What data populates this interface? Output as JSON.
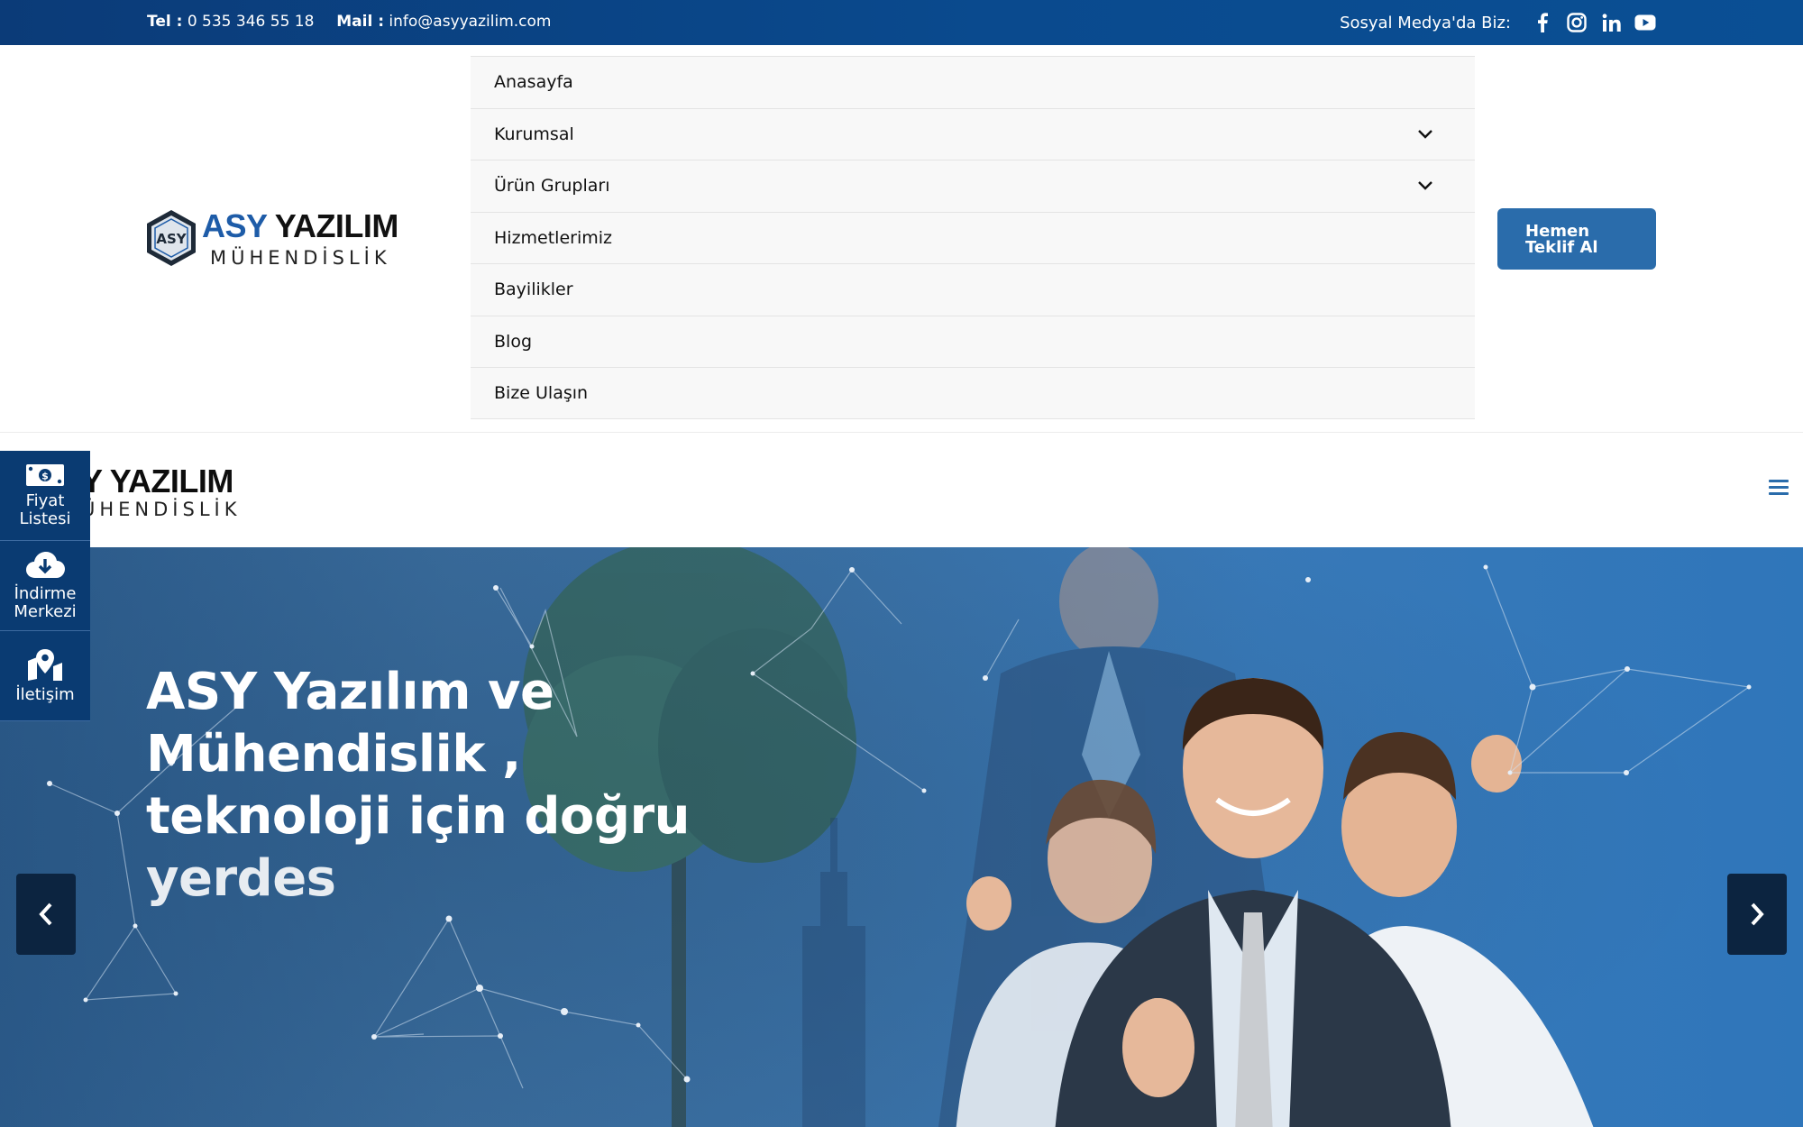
{
  "topbar": {
    "tel_label": "Tel :",
    "tel_value": "0 535 346 55 18",
    "mail_label": "Mail :",
    "mail_value": "info@asyyazilim.com",
    "social_label": "Sosyal Medya'da Biz:",
    "social_icons": [
      "facebook-icon",
      "instagram-icon",
      "linkedin-icon",
      "youtube-icon"
    ]
  },
  "logo": {
    "badge": "ASY",
    "word1": "ASY",
    "word2": "YAZILIM",
    "subtitle": "MÜHENDİSLİK"
  },
  "nav": {
    "items": [
      {
        "label": "Anasayfa",
        "has_dropdown": false
      },
      {
        "label": "Kurumsal",
        "has_dropdown": true
      },
      {
        "label": "Ürün Grupları",
        "has_dropdown": true
      },
      {
        "label": "Hizmetlerimiz",
        "has_dropdown": false
      },
      {
        "label": "Bayilikler",
        "has_dropdown": false
      },
      {
        "label": "Blog",
        "has_dropdown": false
      },
      {
        "label": "Bize Ulaşın",
        "has_dropdown": false
      }
    ]
  },
  "cta": {
    "line1": "Hemen",
    "line2": "Teklif Al"
  },
  "sticky": {
    "logo_title": "Y YAZILIM",
    "logo_subtitle": "ÜHENDİSLİK"
  },
  "side_panel": [
    {
      "line1": "Fiyat",
      "line2": "Listesi",
      "icon": "money-icon"
    },
    {
      "line1": "İndirme",
      "line2": "Merkezi",
      "icon": "cloud-download-icon"
    },
    {
      "line1": "İletişim",
      "line2": "",
      "icon": "map-pin-icon"
    }
  ],
  "hero": {
    "line1": "ASY Yazılım ve",
    "line2": "Mühendislik ,",
    "line3": "teknoloji için doğru",
    "line4": "yerdes"
  },
  "colors": {
    "topbar": "#0b3b78",
    "brand_blue": "#1e5ca8",
    "cta": "#2a6cab",
    "side_panel": "#0a3b72",
    "arrow": "#0c2440"
  }
}
